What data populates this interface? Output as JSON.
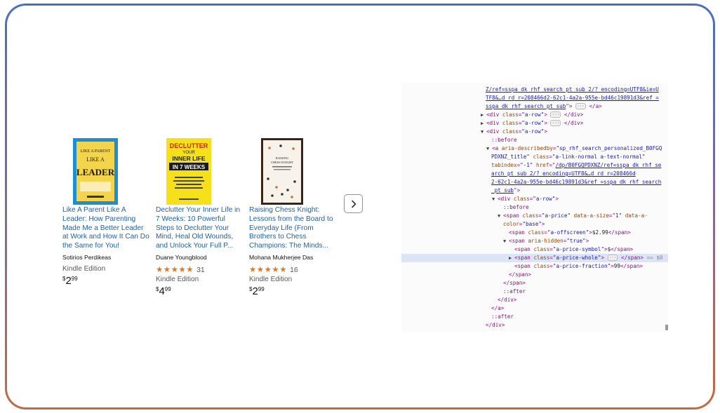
{
  "products": [
    {
      "title": "Like A Parent Like A Leader: How Parenting Made Me a Better Leader at Work and How It Can Do the Same for You!",
      "author": "Sotirios Perdikeas",
      "format": "Kindle Edition",
      "price": {
        "symbol": "$",
        "whole": "2",
        "fraction": "99"
      },
      "cover_text": [
        "LIKE A PARENT",
        "LIKE A",
        "LEADER"
      ]
    },
    {
      "title": "Declutter Your Inner Life in 7 Weeks: 10 Powerful Steps to Declutter Your Mind, Heal Old Wounds, and Unlock Your Full P...",
      "author": "Duane Youngblood",
      "rating": {
        "stars": "★★★★★",
        "count": "31"
      },
      "format": "Kindle Edition",
      "price": {
        "symbol": "$",
        "whole": "4",
        "fraction": "99"
      },
      "cover_text": [
        "DECLUTTER",
        "YOUR",
        "INNER LIFE",
        "IN 7 WEEKS"
      ]
    },
    {
      "title": "Raising Chess Knight: Lessons from the Board to Everyday Life (From Brothers to Chess Champions: The Minds...",
      "author": "Mohana Mukherjee Das",
      "rating": {
        "stars": "★★★★★",
        "count": "16"
      },
      "format": "Kindle Edition",
      "price": {
        "symbol": "$",
        "whole": "2",
        "fraction": "99"
      },
      "cover_text": [
        "RAISING",
        "CHESS KNIGHT"
      ]
    }
  ],
  "carousel": {
    "next_icon": "chevron-right-icon"
  },
  "devtools": {
    "url_1": "Z/ref=sspa_dk_rhf_search_pt_sub_2/?_encoding=UTF8&ie=U",
    "url_2": "TF8&…d_rd_r=208466d2-62c1-4a2a-955e-bd46c19891d3&ref_=",
    "url_3": "sspa_dk_rhf_search_pt_sub",
    "row_tag": "div",
    "row_attr": "class",
    "row_val": "\"a-row\"",
    "before": "::before",
    "after": "::after",
    "a_describedby": "\"sp_rhf_search_personalized_B0FGQ",
    "a_describedby_2": "PDXNZ_title\"",
    "a_class": "\"a-link-normal a-text-normal\"",
    "a_tabindex": "\"-1\"",
    "a_href_1": "/dp/B0FGQPDXNZ/ref=sspa_dk_rhf_se",
    "a_href_2": "arch_pt_sub_2/?_encoding=UTF8&…d_rd_r=208466d",
    "a_href_3": "2-62c1-4a2a-955e-bd46c19891d3&ref_=sspa_dk_rhf_search",
    "a_href_4": "_pt_sub",
    "price_class": "\"a-price\"",
    "price_size": "\"1\"",
    "price_color": "\"base\"",
    "offscreen_class": "\"a-offscreen\"",
    "offscreen_text": "$2.99",
    "aria_hidden": "\"true\"",
    "symbol_class": "\"a-price-symbol\"",
    "symbol_text": "$",
    "whole_class": "\"a-price-whole\"",
    "selected_marker": "== $0",
    "fraction_class": "\"a-price-fraction\"",
    "fraction_text": "99"
  }
}
